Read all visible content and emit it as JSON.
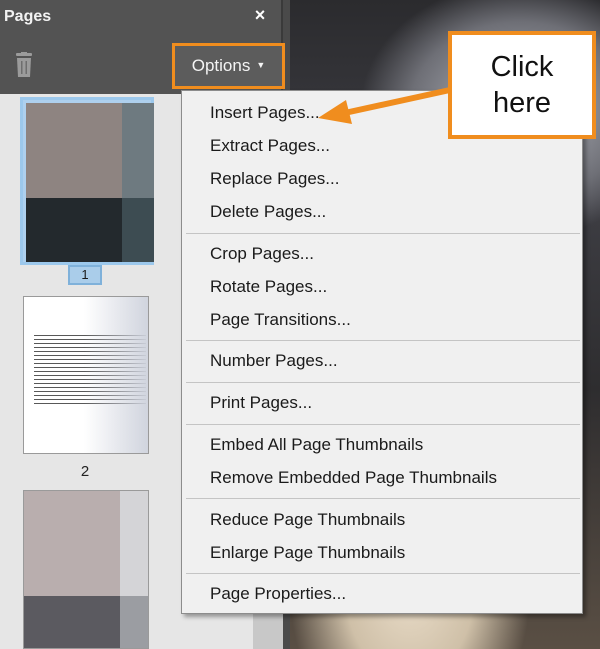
{
  "panel": {
    "title": "Pages",
    "close_glyph": "×",
    "options_label": "Options",
    "caret_glyph": "▼"
  },
  "thumbnails": [
    {
      "page_number": "1",
      "selected": true
    },
    {
      "page_number": "2",
      "selected": false
    },
    {
      "page_number": "",
      "selected": false
    }
  ],
  "menu": {
    "items": [
      "Insert Pages...",
      "Extract Pages...",
      "Replace Pages...",
      "Delete Pages...",
      "Crop Pages...",
      "Rotate Pages...",
      "Page Transitions...",
      "Number Pages...",
      "Print Pages...",
      "Embed All Page Thumbnails",
      "Remove Embedded Page Thumbnails",
      "Reduce Page Thumbnails",
      "Enlarge Page Thumbnails",
      "Page Properties..."
    ]
  },
  "callout": {
    "line1": "Click",
    "line2": "here"
  },
  "colors": {
    "accent": "#f08d1e",
    "selection": "#9cc8ec",
    "panel": "#535353",
    "menu": "#f0f0f0"
  },
  "icons": [
    "trash-icon",
    "close-icon",
    "caret-down-icon",
    "arrow-icon"
  ]
}
